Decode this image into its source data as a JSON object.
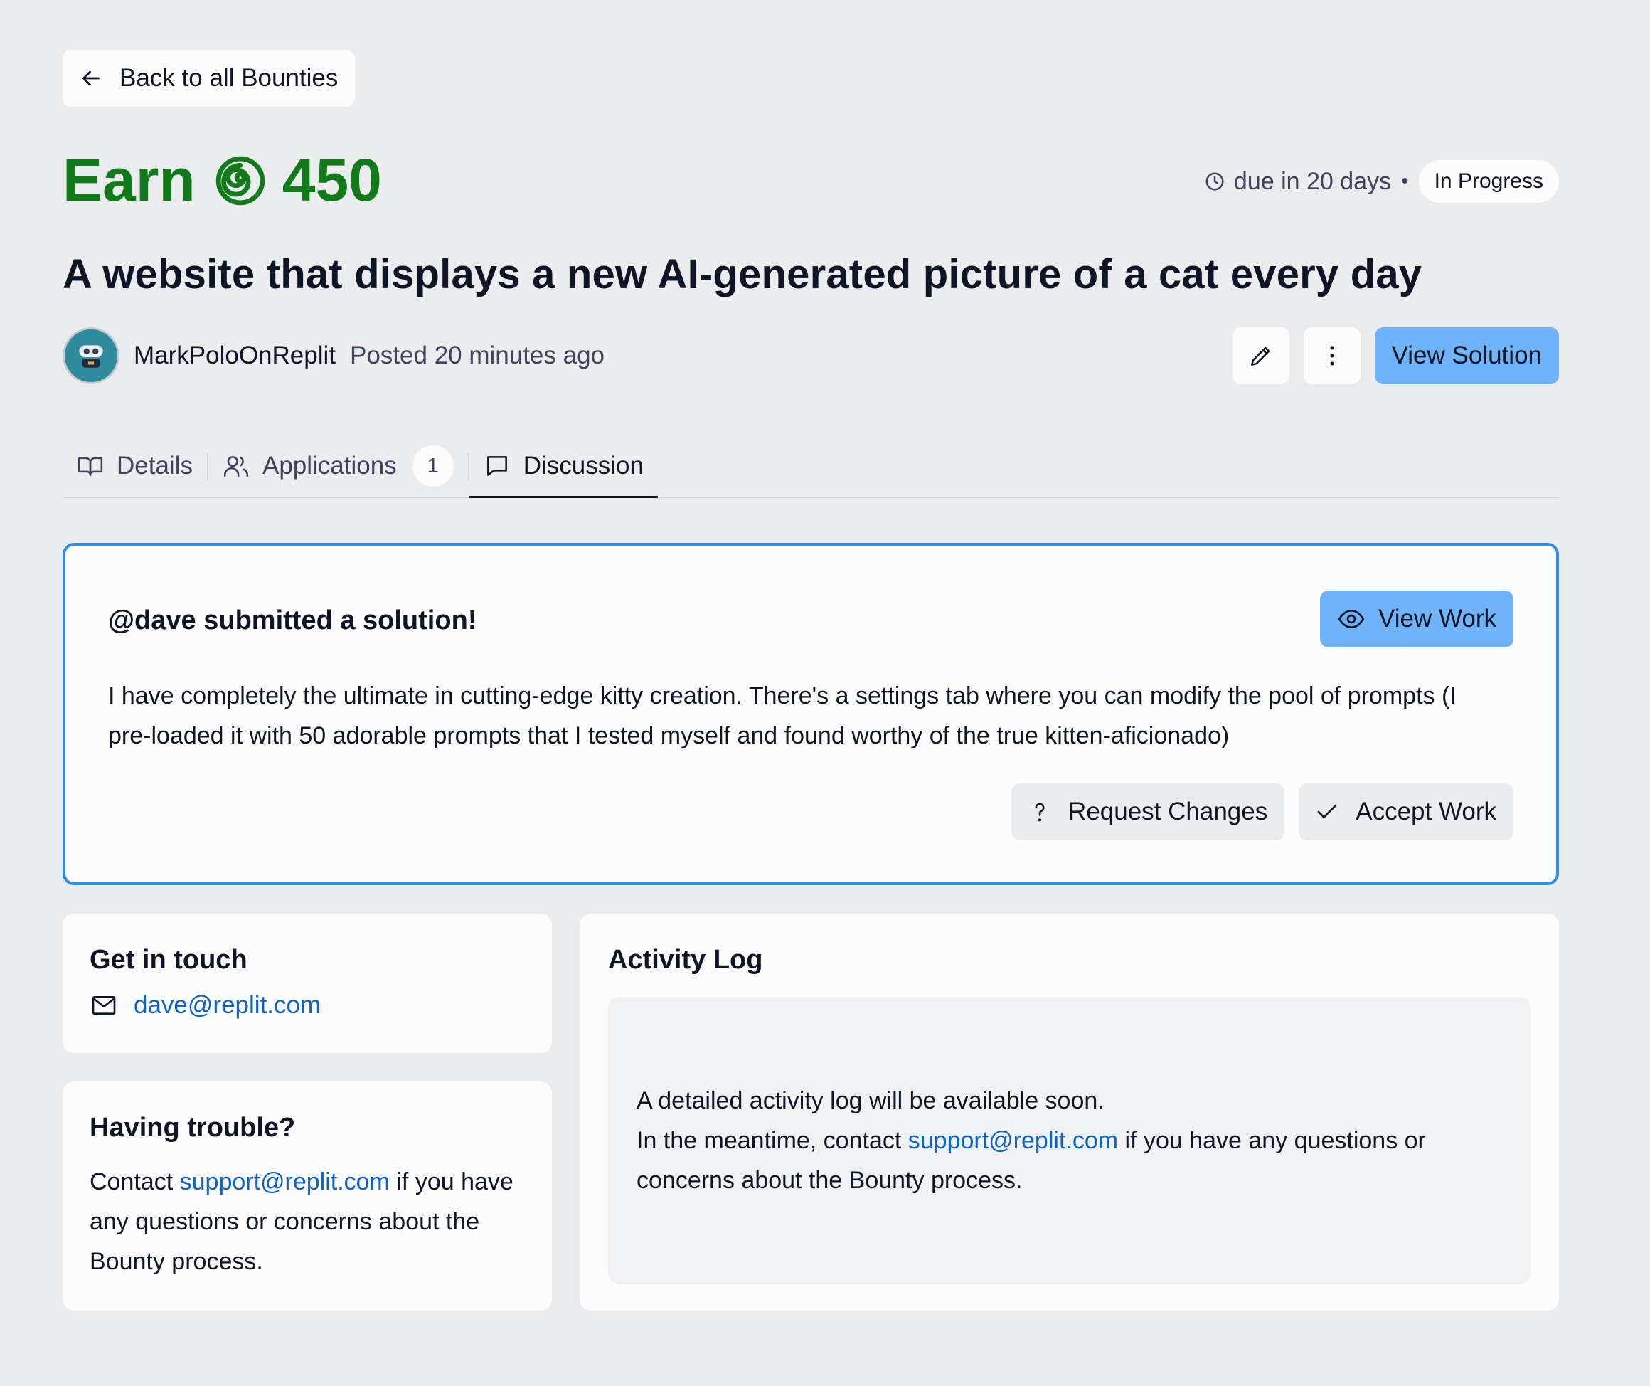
{
  "back": {
    "label": "Back to all Bounties"
  },
  "bounty": {
    "earn_label": "Earn",
    "amount": "450",
    "due": "due in 20 days",
    "dot": "•",
    "status": "In Progress",
    "title": "A website that displays a new AI-generated picture of a cat every day"
  },
  "author": {
    "username": "MarkPoloOnReplit",
    "posted": "Posted 20 minutes ago"
  },
  "actions": {
    "view_solution": "View Solution"
  },
  "tabs": [
    {
      "label": "Details",
      "icon": "book-icon"
    },
    {
      "label": "Applications",
      "icon": "users-icon",
      "count": "1"
    },
    {
      "label": "Discussion",
      "icon": "chat-icon",
      "active": true
    }
  ],
  "solution": {
    "heading": "@dave submitted a solution!",
    "view_work": "View Work",
    "body": "I have completely the ultimate in cutting-edge kitty creation. There's a settings tab where you can modify the pool of prompts (I pre-loaded it with 50 adorable prompts that I tested myself and found worthy of the true kitten-aficionado)",
    "request_changes": "Request Changes",
    "accept_work": "Accept Work"
  },
  "contact": {
    "heading": "Get in touch",
    "email": "dave@replit.com"
  },
  "trouble": {
    "heading": "Having trouble?",
    "text_before": "Contact ",
    "link": "support@replit.com",
    "text_after": " if you have any questions or concerns about the Bounty process."
  },
  "activity": {
    "heading": "Activity Log",
    "line1": "A detailed activity log will be available soon.",
    "text_before": "In the meantime, contact ",
    "link": "support@replit.com",
    "text_after": " if you have any questions or concerns about the Bounty process."
  },
  "colors": {
    "background": "#ebecee",
    "earn_green": "#137a1b",
    "primary_blue": "#6fb3fb",
    "card_border": "#2f8ef0",
    "link_blue": "#0b63c7"
  }
}
